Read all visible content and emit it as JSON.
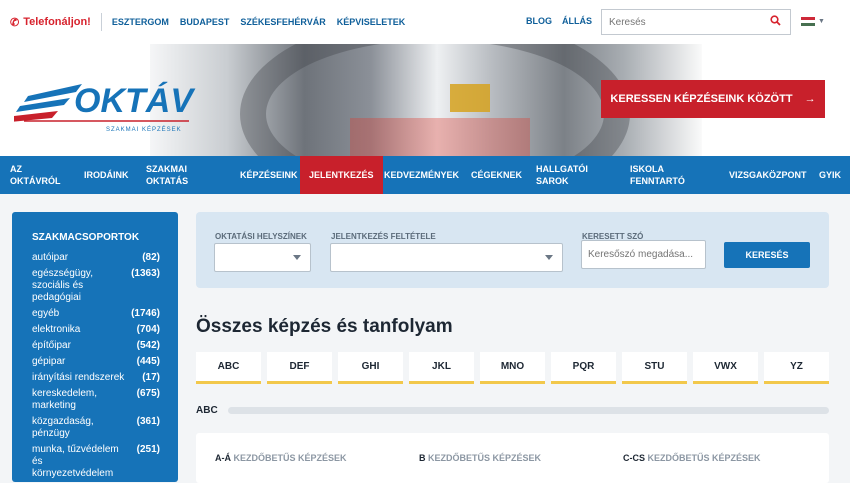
{
  "topbar": {
    "phone_label": "Telefonáljon!",
    "cities": [
      "ESZTERGOM",
      "BUDAPEST",
      "SZÉKESFEHÉRVÁR",
      "KÉPVISELETEK"
    ],
    "right_links": [
      "BLOG",
      "ÁLLÁS"
    ],
    "search_placeholder": "Keresés"
  },
  "hero": {
    "logo_text": "OKTÁV",
    "logo_subtitle": "SZAKMAI KÉPZÉSEK",
    "cta_label": "KERESSEN KÉPZÉSEINK KÖZÖTT",
    "cta_arrow": "→"
  },
  "nav": {
    "items": [
      {
        "label": "AZ\nOKTÁVRÓL"
      },
      {
        "label": "IRODÁINK"
      },
      {
        "label": "SZAKMAI\nOKTATÁS"
      },
      {
        "label": "KÉPZÉSEINK"
      },
      {
        "label": "JELENTKEZÉS"
      },
      {
        "label": "KEDVEZMÉNYEK"
      },
      {
        "label": "CÉGEKNEK"
      },
      {
        "label": "HALLGATÓI\nSAROK"
      },
      {
        "label": "ISKOLA\nFENNTARTÓ"
      },
      {
        "label": "VIZSGAKÖZPONT"
      },
      {
        "label": "GYIK"
      }
    ]
  },
  "sidebar": {
    "title": "SZAKMACSOPORTOK",
    "categories": [
      {
        "name": "autóipar",
        "count": "(82)"
      },
      {
        "name": "egészségügy, szociális és pedagógiai",
        "count": "(1363)"
      },
      {
        "name": "egyéb",
        "count": "(1746)"
      },
      {
        "name": "elektronika",
        "count": "(704)"
      },
      {
        "name": "építőipar",
        "count": "(542)"
      },
      {
        "name": "gépipar",
        "count": "(445)"
      },
      {
        "name": "irányítási rendszerek",
        "count": "(17)"
      },
      {
        "name": "kereskedelem, marketing",
        "count": "(675)"
      },
      {
        "name": "közgazdaság, pénzügy",
        "count": "(361)"
      },
      {
        "name": "munka, tűzvédelem és környezetvédelem",
        "count": "(251)"
      }
    ]
  },
  "filter": {
    "location_label": "OKTATÁSI HELYSZÍNEK",
    "condition_label": "JELENTKEZÉS FELTÉTELE",
    "keyword_label": "KERESETT SZÓ",
    "keyword_placeholder": "Keresőszó megadása...",
    "search_button": "KERESÉS"
  },
  "main": {
    "heading": "Összes képzés és tanfolyam",
    "alphabet": [
      "ABC",
      "DEF",
      "GHI",
      "JKL",
      "MNO",
      "PQR",
      "STU",
      "VWX",
      "YZ"
    ],
    "section_label": "ABC",
    "columns": [
      {
        "strong": "A-Á",
        "rest": "KEZDŐBETŰS KÉPZÉSEK"
      },
      {
        "strong": "B",
        "rest": "KEZDŐBETŰS KÉPZÉSEK"
      },
      {
        "strong": "C-CS",
        "rest": "KEZDŐBETŰS KÉPZÉSEK"
      }
    ]
  },
  "colors": {
    "brand_blue": "#1673b8",
    "brand_red": "#c8202b",
    "accent_yellow": "#f2c84b"
  }
}
